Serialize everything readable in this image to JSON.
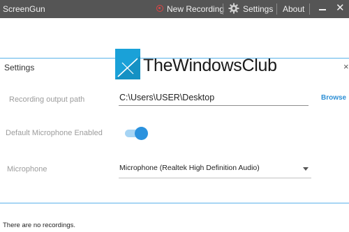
{
  "window": {
    "title": "ScreenGun"
  },
  "toolbar": {
    "new_recording": "New Recording",
    "settings": "Settings",
    "about": "About",
    "minimize": "minimize",
    "close": "✕"
  },
  "settings_panel": {
    "title": "Settings",
    "close": "×",
    "output_path": {
      "label": "Recording output path",
      "value": "C:\\Users\\USER\\Desktop",
      "browse": "Browse"
    },
    "default_mic": {
      "label": "Default Microphone Enabled",
      "enabled": true
    },
    "microphone": {
      "label": "Microphone",
      "value": "Microphone (Realtek High Definition Audio)"
    }
  },
  "watermark": {
    "text": "TheWindowsClub"
  },
  "recordings": {
    "empty_message": "There are no recordings."
  },
  "colors": {
    "accent": "#2b92de",
    "titlebar": "#555555",
    "record": "#e04545",
    "logo": "#1aa1d8"
  }
}
